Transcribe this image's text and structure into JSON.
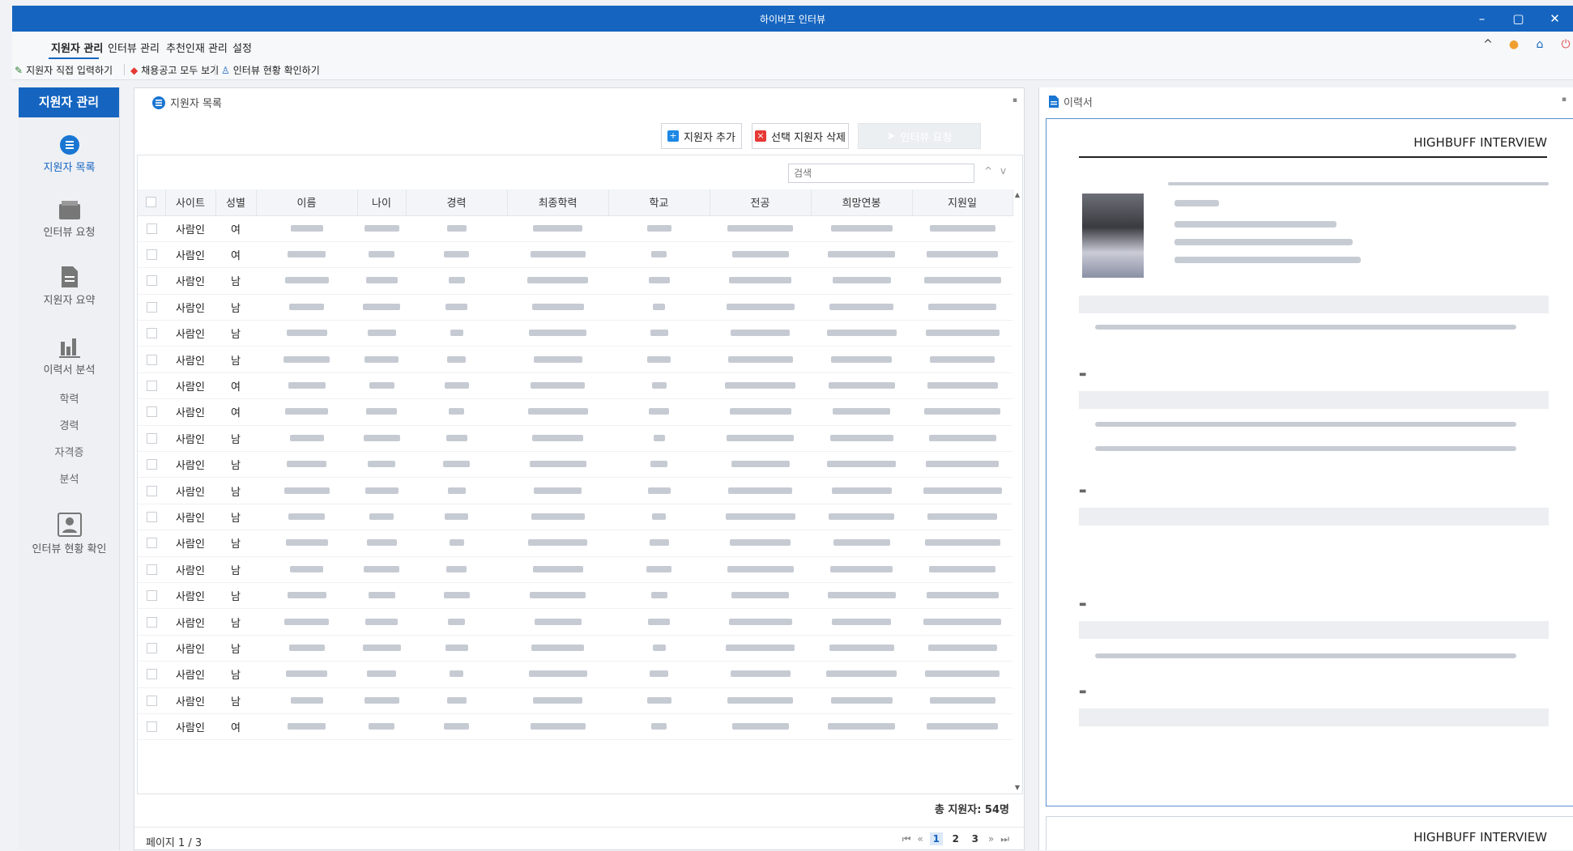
{
  "window": {
    "title": "하이버프 인터뷰",
    "controls": [
      "–",
      "▢",
      "✕"
    ]
  },
  "menu": {
    "items": [
      "지원자 관리",
      "인터뷰 관리",
      "추천인재 관리",
      "설정"
    ]
  },
  "toolbar": {
    "items": [
      "지원자 직접 입력하기",
      "채용공고 모두 보기",
      "인터뷰 현황 확인하기"
    ]
  },
  "sidebar": {
    "header": "지원자 관리",
    "nav": [
      "지원자 목록",
      "인터뷰 요청",
      "지원자 요약",
      "이력서 분석"
    ],
    "sub": [
      "학력",
      "경력",
      "자격증",
      "분석"
    ],
    "last": "인터뷰 현황 확인"
  },
  "list": {
    "title": "지원자 목록",
    "buttons": {
      "add": "지원자 추가",
      "delete": "선택 지원자 삭제",
      "request": "인터뷰 요청"
    },
    "search_placeholder": "검색",
    "columns": [
      "사이트",
      "성별",
      "이름",
      "나이",
      "경력",
      "최종학력",
      "학교",
      "전공",
      "희망연봉",
      "지원일"
    ],
    "rows": [
      {
        "site": "사람인",
        "gender": "여"
      },
      {
        "site": "사람인",
        "gender": "여"
      },
      {
        "site": "사람인",
        "gender": "남"
      },
      {
        "site": "사람인",
        "gender": "남"
      },
      {
        "site": "사람인",
        "gender": "남"
      },
      {
        "site": "사람인",
        "gender": "남"
      },
      {
        "site": "사람인",
        "gender": "여"
      },
      {
        "site": "사람인",
        "gender": "여"
      },
      {
        "site": "사람인",
        "gender": "남"
      },
      {
        "site": "사람인",
        "gender": "남"
      },
      {
        "site": "사람인",
        "gender": "남"
      },
      {
        "site": "사람인",
        "gender": "남"
      },
      {
        "site": "사람인",
        "gender": "남"
      },
      {
        "site": "사람인",
        "gender": "남"
      },
      {
        "site": "사람인",
        "gender": "남"
      },
      {
        "site": "사람인",
        "gender": "남"
      },
      {
        "site": "사람인",
        "gender": "남"
      },
      {
        "site": "사람인",
        "gender": "남"
      },
      {
        "site": "사람인",
        "gender": "남"
      },
      {
        "site": "사람인",
        "gender": "여"
      }
    ],
    "total": "총 지원자: 54명",
    "page_info": "페이지 1 / 3",
    "pages": [
      "1",
      "2",
      "3"
    ]
  },
  "resume": {
    "title": "이력서",
    "brand": "HIGHBUFF INTERVIEW",
    "brand2": "HIGHBUFF INTERVIEW"
  }
}
